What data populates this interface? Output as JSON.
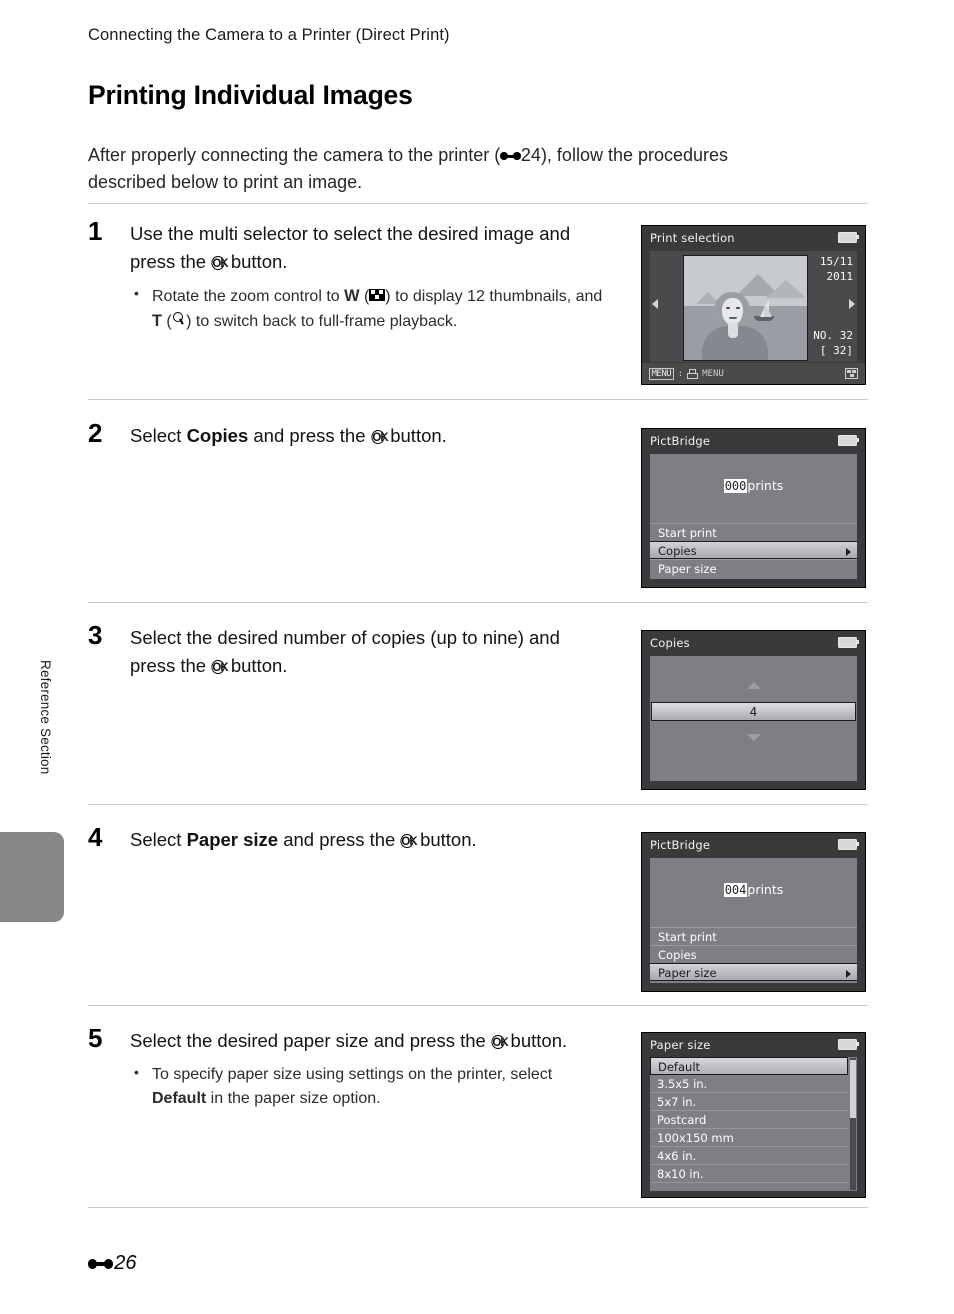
{
  "sidebar": {
    "label": "Reference Section",
    "tab_color": "#878787"
  },
  "header": {
    "running_head": "Connecting the Camera to a Printer (Direct Print)",
    "title": "Printing Individual Images",
    "intro_before": "After properly connecting the camera to the printer (",
    "intro_ref": "24",
    "intro_after": "), follow the procedures described below to print an image."
  },
  "steps": [
    {
      "number": "1",
      "text_parts": [
        "Use the multi selector to select the desired image and press the ",
        "OK",
        " button."
      ],
      "bullets": [
        "Rotate the zoom control to W (thumbnail-icon) to display 12 thumbnails, and T (magnifier-icon) to switch back to full-frame playback."
      ],
      "bullet_fragments": {
        "b1_a": "Rotate the zoom control to ",
        "b1_w": "W",
        "b1_b": " (",
        "b1_c": ") to display 12 thumbnails, and ",
        "b1_t": "T",
        "b1_d": " (",
        "b1_e": ") to switch back to full-frame playback."
      }
    },
    {
      "number": "2",
      "text_parts": [
        "Select ",
        "Copies",
        " and press the ",
        "OK",
        " button."
      ]
    },
    {
      "number": "3",
      "text_parts": [
        "Select the desired number of copies (up to nine) and press the ",
        "OK",
        " button."
      ]
    },
    {
      "number": "4",
      "text_parts": [
        "Select ",
        "Paper size",
        " and press the ",
        "OK",
        " button."
      ]
    },
    {
      "number": "5",
      "text_parts": [
        "Select the desired paper size and press the ",
        "OK",
        " button."
      ],
      "bullet_fragments": {
        "b1_a": "To specify paper size using settings on the printer, select ",
        "b1_bold": "Default",
        "b1_b": " in the paper size option."
      }
    }
  ],
  "screens": {
    "print_selection": {
      "title": "Print selection",
      "date": "15/11",
      "year": "2011",
      "number_label": "NO. 32",
      "bracket_label": "[  32]",
      "bottom_menu_badge": "MENU",
      "bottom_sep": ":",
      "bottom_menu_text": "MENU",
      "icons": {
        "battery": "battery-icon",
        "printer": "printer-icon",
        "thumbnail": "thumbnail-view-icon",
        "left_arrow": "left-arrow-icon",
        "right_arrow": "right-arrow-icon"
      }
    },
    "pictbridge_step2": {
      "title": "PictBridge",
      "count": "000",
      "count_unit": "prints",
      "items": [
        {
          "label": "Start print",
          "selected": false
        },
        {
          "label": "Copies",
          "selected": true
        },
        {
          "label": "Paper size",
          "selected": false
        }
      ]
    },
    "copies": {
      "title": "Copies",
      "value": "4"
    },
    "pictbridge_step4": {
      "title": "PictBridge",
      "count": "004",
      "count_unit": "prints",
      "items": [
        {
          "label": "Start print",
          "selected": false
        },
        {
          "label": "Copies",
          "selected": false
        },
        {
          "label": "Paper size",
          "selected": true
        }
      ]
    },
    "paper_size": {
      "title": "Paper size",
      "items": [
        {
          "label": "Default",
          "selected": true
        },
        {
          "label": "3.5x5 in.",
          "selected": false
        },
        {
          "label": "5x7 in.",
          "selected": false
        },
        {
          "label": "Postcard",
          "selected": false
        },
        {
          "label": "100x150 mm",
          "selected": false
        },
        {
          "label": "4x6 in.",
          "selected": false
        },
        {
          "label": "8x10 in.",
          "selected": false
        }
      ]
    }
  },
  "footer": {
    "page_number": "26"
  }
}
